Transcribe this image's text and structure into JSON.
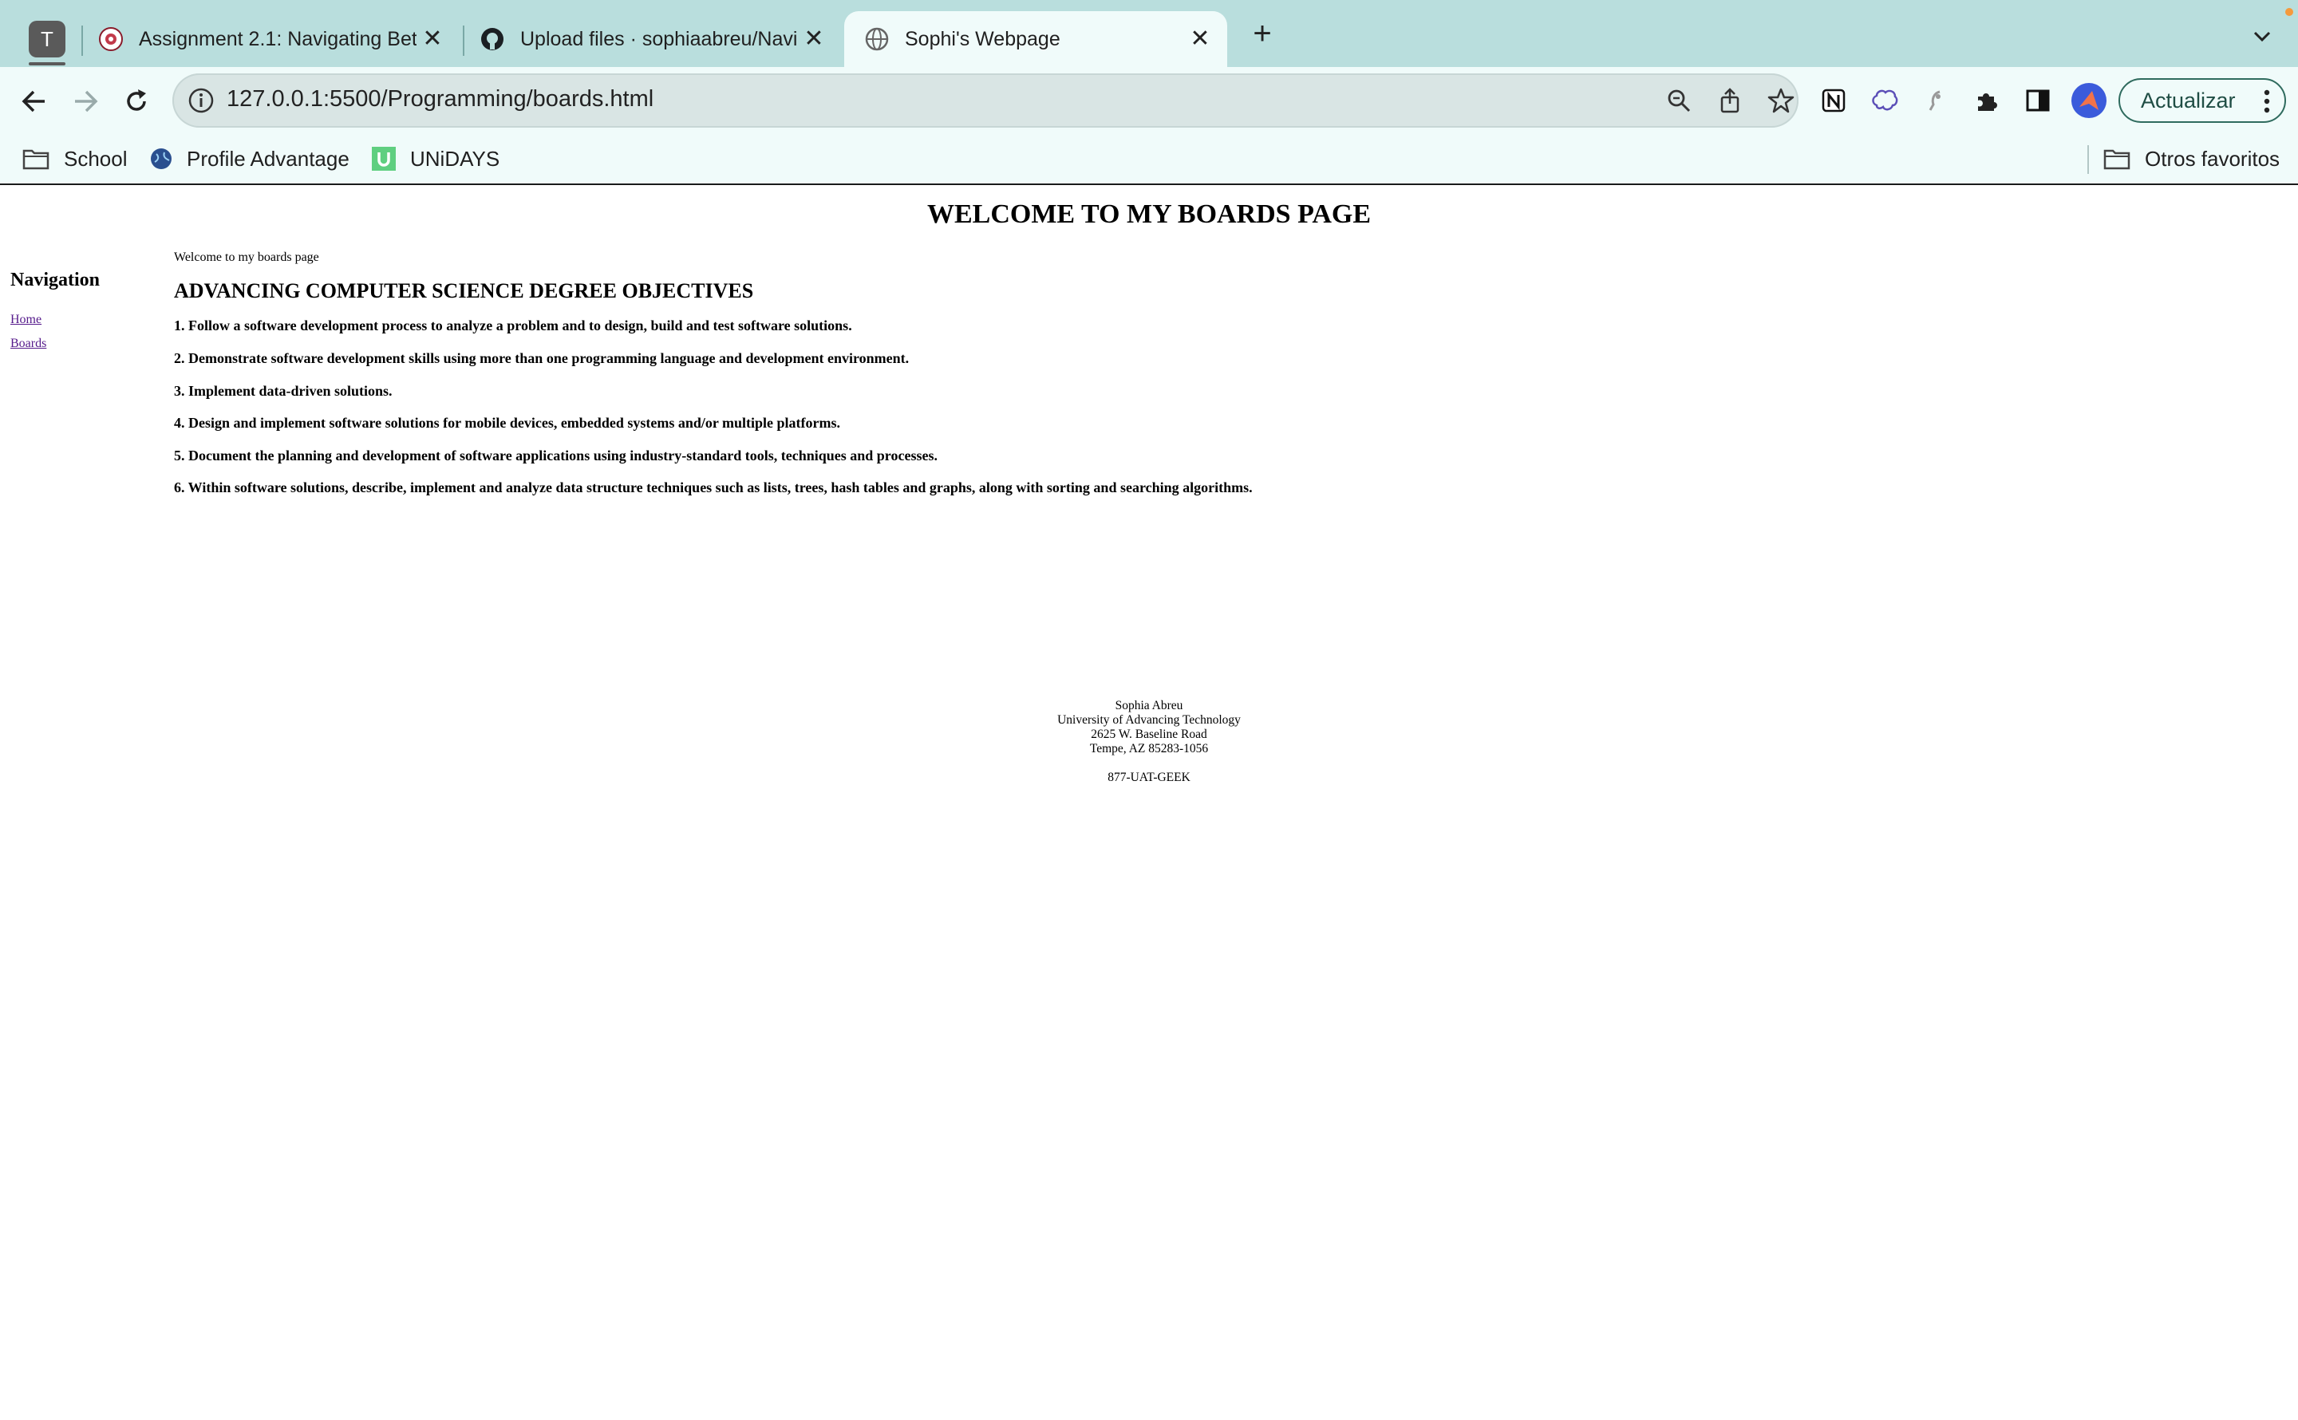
{
  "browser": {
    "profile_initial": "T",
    "tabs": [
      {
        "title": "Assignment 2.1: Navigating Bet",
        "close": "✕"
      },
      {
        "title": "Upload files · sophiaabreu/Navi",
        "close": "✕"
      },
      {
        "title": "Sophi's Webpage",
        "close": "✕"
      }
    ],
    "new_tab": "+",
    "url": "127.0.0.1:5500/Programming/boards.html",
    "update_button": "Actualizar",
    "bookmarks": [
      {
        "label": "School"
      },
      {
        "label": "Profile Advantage"
      },
      {
        "label": "UNiDAYS"
      }
    ],
    "other_bookmarks": "Otros favoritos",
    "colors": {
      "tab_strip": "#b9dedd",
      "toolbar": "#f0fbfa",
      "omnibox": "#d9e5e4",
      "visited_link": "#551a8b"
    }
  },
  "page": {
    "title": "WELCOME TO MY BOARDS PAGE",
    "nav": {
      "heading": "Navigation",
      "links": [
        "Home",
        "Boards"
      ]
    },
    "welcome_text": "Welcome to my boards page",
    "objectives_heading": "ADVANCING COMPUTER SCIENCE DEGREE OBJECTIVES",
    "objectives": [
      "1. Follow a software development process to analyze a problem and to design, build and test software solutions.",
      "2. Demonstrate software development skills using more than one programming language and development environment.",
      "3. Implement data-driven solutions.",
      "4. Design and implement software solutions for mobile devices, embedded systems and/or multiple platforms.",
      "5. Document the planning and development of software applications using industry-standard tools, techniques and processes.",
      "6. Within software solutions, describe, implement and analyze data structure techniques such as lists, trees, hash tables and graphs, along with sorting and searching algorithms."
    ],
    "footer": {
      "name": "Sophia Abreu",
      "school": "University of Advancing Technology",
      "street": "2625 W. Baseline Road",
      "city": "Tempe, AZ 85283-1056",
      "phone": "877-UAT-GEEK"
    }
  }
}
